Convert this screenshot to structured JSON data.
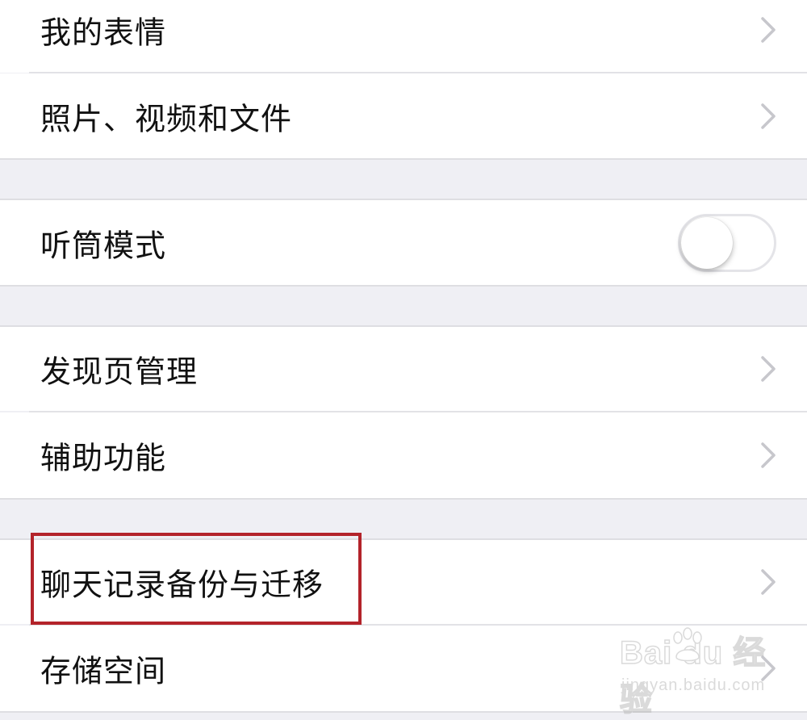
{
  "settings": {
    "items": [
      {
        "label": "我的表情"
      },
      {
        "label": "照片、视频和文件"
      },
      {
        "label": "听筒模式",
        "toggle_on": false
      },
      {
        "label": "发现页管理"
      },
      {
        "label": "辅助功能"
      },
      {
        "label": "聊天记录备份与迁移",
        "highlighted": true
      },
      {
        "label": "存储空间"
      }
    ]
  },
  "colors": {
    "background": "#efeff4",
    "row": "#ffffff",
    "highlight_border": "#b3232a",
    "chevron": "#c7c7cc"
  },
  "icons": {
    "chevron": "chevron-right-icon",
    "toggle": "toggle-switch"
  },
  "watermark": {
    "brand": "Bai du 经验",
    "sub": "jingyan.baidu.com"
  }
}
